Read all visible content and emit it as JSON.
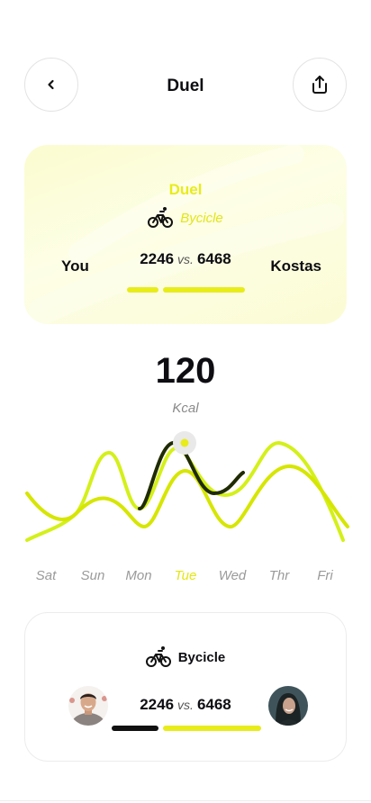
{
  "header": {
    "title": "Duel",
    "back_icon": "chevron-left-icon",
    "share_icon": "share-icon"
  },
  "duel_card": {
    "title": "Duel",
    "sport": "Bycicle",
    "sport_icon": "bicycle-icon",
    "player_left": "You",
    "player_right": "Kostas",
    "score_left": "2246",
    "vs": "vs.",
    "score_right": "6468",
    "accent_color": "#e8ec1a"
  },
  "stats": {
    "value": "120",
    "unit": "Kcal"
  },
  "chart_data": {
    "type": "line",
    "categories": [
      "Sat",
      "Sun",
      "Mon",
      "Tue",
      "Wed",
      "Thr",
      "Fri"
    ],
    "selected": "Tue",
    "series": [
      {
        "color": "#d4f01a",
        "values": [
          10,
          30,
          38,
          48,
          36,
          46,
          4
        ]
      },
      {
        "color": "#5a6b05",
        "values": [
          2,
          26,
          34,
          40,
          32,
          37,
          2
        ]
      }
    ]
  },
  "days": [
    "Sat",
    "Sun",
    "Mon",
    "Tue",
    "Wed",
    "Thr",
    "Fri"
  ],
  "summary": {
    "sport": "Bycicle",
    "score_left": "2246",
    "vs": "vs.",
    "score_right": "6468",
    "left_bar_color": "#111111",
    "right_bar_color": "#e8ec1a"
  }
}
